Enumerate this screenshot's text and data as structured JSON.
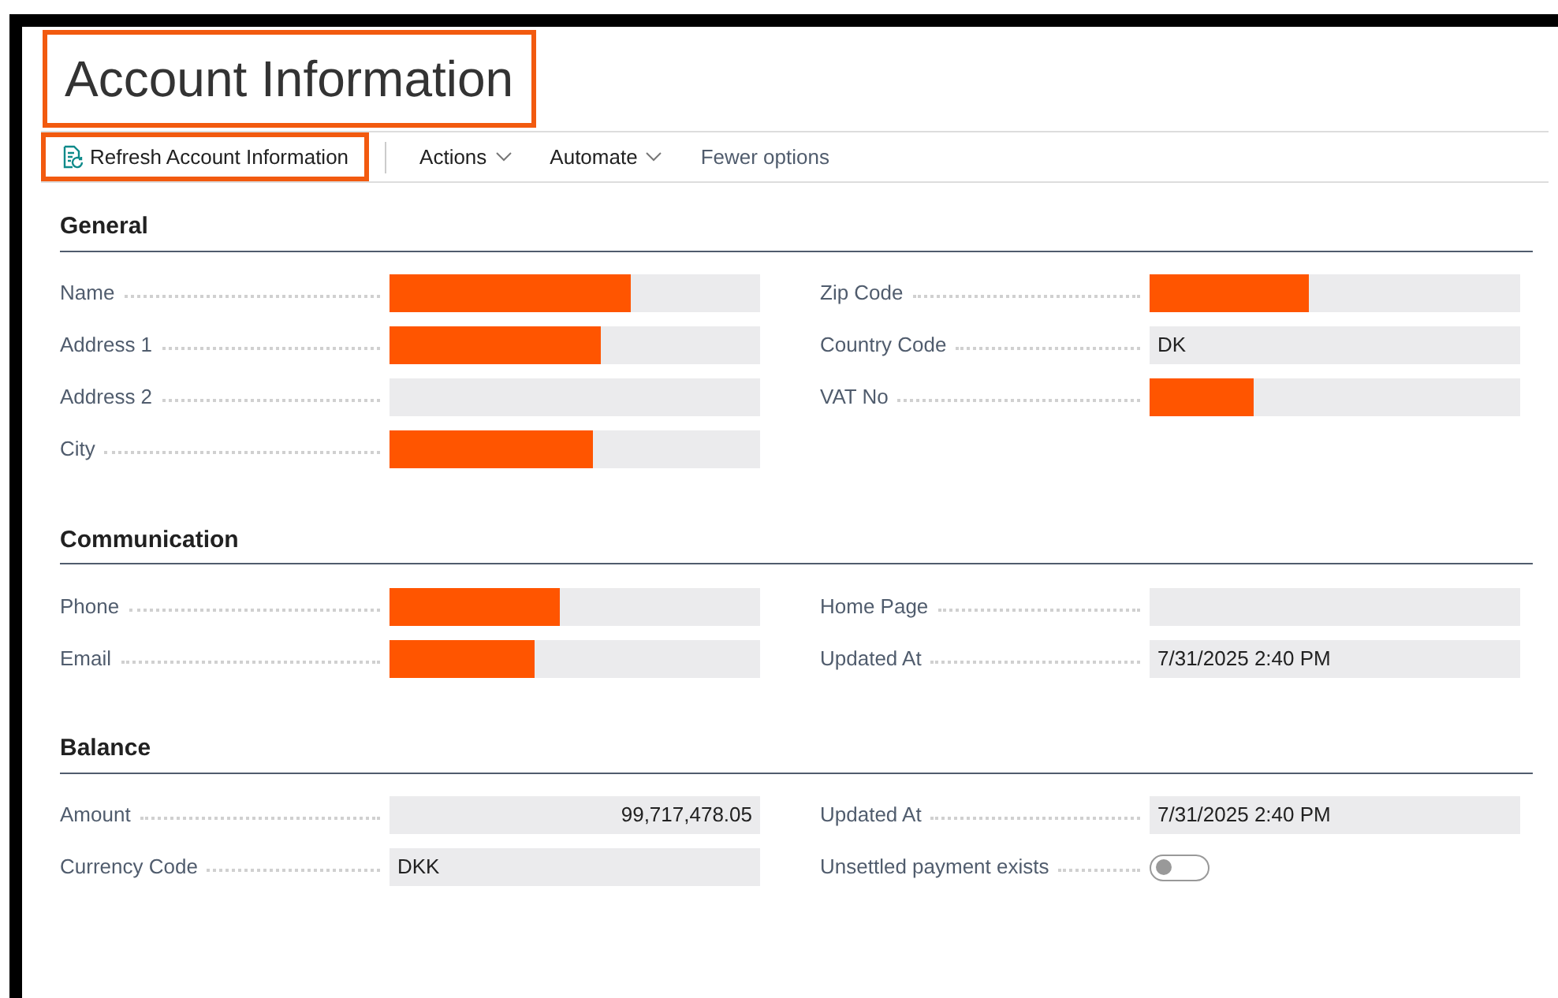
{
  "page": {
    "title": "Account Information",
    "highlighted": true
  },
  "toolbar": [
    {
      "kind": "button",
      "label": "Refresh Account Information",
      "highlighted": true
    },
    {
      "kind": "menu",
      "label": "Actions",
      "highlighted": false
    },
    {
      "kind": "menu",
      "label": "Automate",
      "highlighted": false
    },
    {
      "kind": "link",
      "label": "Fewer options",
      "highlighted": false
    }
  ],
  "sections": [
    {
      "title": "General",
      "left": [
        {
          "label": "Name",
          "kind": "redacted"
        },
        {
          "label": "Address 1",
          "kind": "redacted"
        },
        {
          "label": "Address 2",
          "kind": "text"
        },
        {
          "label": "City",
          "kind": "redacted"
        }
      ],
      "right": [
        {
          "label": "Zip Code",
          "kind": "redacted"
        },
        {
          "label": "Country Code",
          "kind": "text",
          "value": "DK"
        },
        {
          "label": "VAT No",
          "kind": "redacted"
        }
      ]
    },
    {
      "title": "Communication",
      "left": [
        {
          "label": "Phone",
          "kind": "redacted"
        },
        {
          "label": "Email",
          "kind": "redacted"
        }
      ],
      "right": [
        {
          "label": "Home Page",
          "kind": "text"
        },
        {
          "label": "Updated At",
          "kind": "text",
          "value": "7/31/2025 2:40 PM"
        }
      ]
    },
    {
      "title": "Balance",
      "left": [
        {
          "label": "Amount",
          "kind": "number",
          "value": "99,717,478.05"
        },
        {
          "label": "Currency Code",
          "kind": "text",
          "value": "DKK"
        }
      ],
      "right": [
        {
          "label": "Updated At",
          "kind": "text",
          "value": "7/31/2025 2:40 PM"
        },
        {
          "label": "Unsettled payment exists",
          "kind": "toggle",
          "on": false
        }
      ]
    }
  ]
}
